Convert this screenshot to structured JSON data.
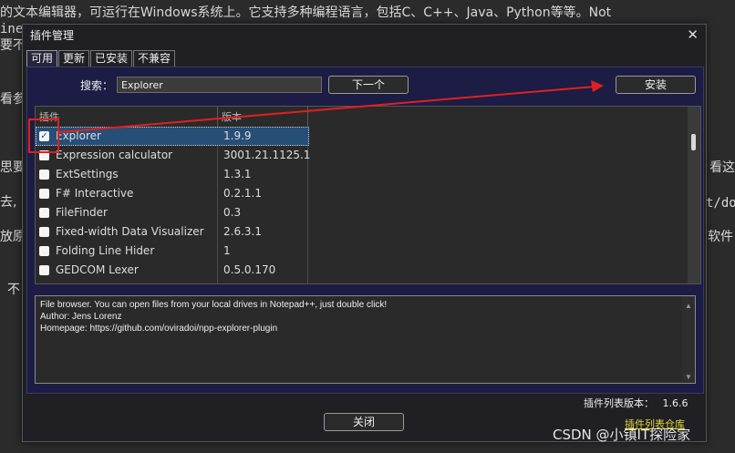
{
  "background": {
    "line1": "的文本编辑器，可运行在Windows系统上。它支持多种编程语言，包括C、C++、Java、Python等等。Not",
    "line2": "ine",
    "line3": "要不",
    "line4": "看参",
    "line5": "思要",
    "line6": "看这",
    "line7": "去,",
    "line8": "t/do",
    "line9": "放原",
    "line10": "软件",
    "line11": "不"
  },
  "dialog": {
    "title": "插件管理",
    "close_label": "✕"
  },
  "tabs": [
    "可用",
    "更新",
    "已安装",
    "不兼容"
  ],
  "search": {
    "label": "搜索：",
    "value": "Explorer"
  },
  "buttons": {
    "next": "下一个",
    "install": "安装",
    "close": "关闭"
  },
  "list": {
    "col_plugin": "插件",
    "col_version": "版本",
    "rows": [
      {
        "name": "Explorer",
        "version": "1.9.9",
        "checked": true
      },
      {
        "name": "Expression calculator",
        "version": "3001.21.1125.1",
        "checked": false
      },
      {
        "name": "ExtSettings",
        "version": "1.3.1",
        "checked": false
      },
      {
        "name": "F# Interactive",
        "version": "0.2.1.1",
        "checked": false
      },
      {
        "name": "FileFinder",
        "version": "0.3",
        "checked": false
      },
      {
        "name": "Fixed-width Data Visualizer",
        "version": "2.6.3.1",
        "checked": false
      },
      {
        "name": "Folding Line Hider",
        "version": "1",
        "checked": false
      },
      {
        "name": "GEDCOM Lexer",
        "version": "0.5.0.170",
        "checked": false
      }
    ]
  },
  "description": {
    "line1": "File browser. You can open files from your local drives in Notepad++, just double click!",
    "line2": "Author: Jens Lorenz",
    "line3": "Homepage: https://github.com/oviradoi/npp-explorer-plugin"
  },
  "footer": {
    "list_version_label": "插件列表版本：",
    "list_version": "1.6.6",
    "repo_link": "插件列表仓库"
  },
  "watermark": "CSDN @小镇IT探险家",
  "colors": {
    "annotation": "#e02020",
    "selection": "#264f78",
    "link": "#e5d93a"
  }
}
